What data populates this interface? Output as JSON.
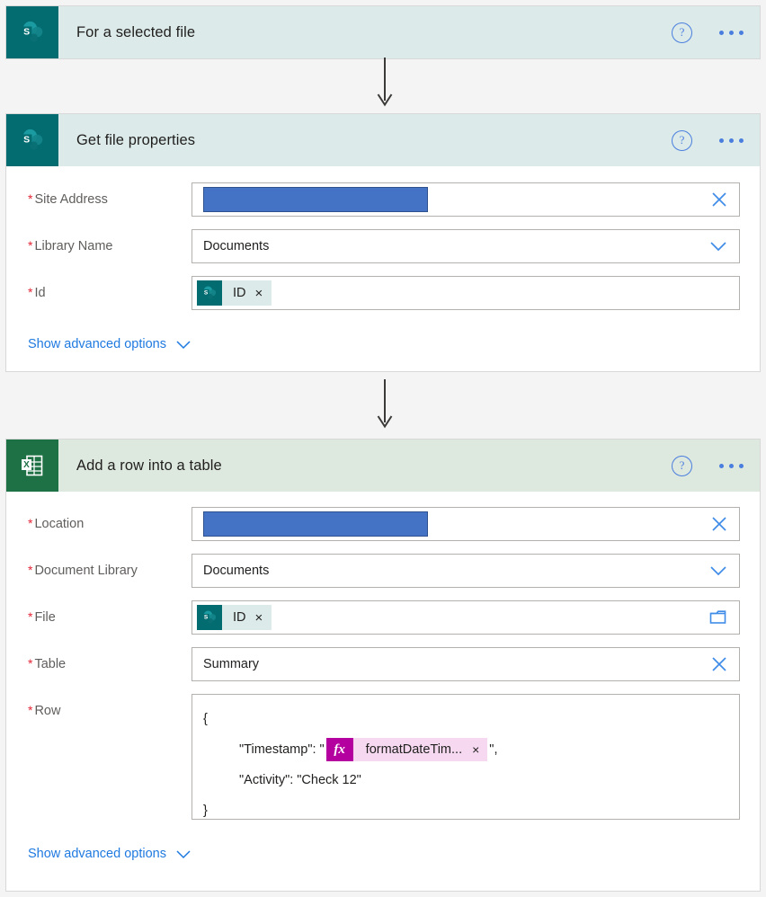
{
  "flow": {
    "steps": [
      {
        "id": "trigger",
        "title": "For a selected file",
        "connector": "SharePoint",
        "icon": "sharepoint-icon",
        "header_bg": "#dcebea",
        "icon_bg": "#036c70",
        "help_label": "?",
        "more_label": "More commands",
        "fields": []
      },
      {
        "id": "get-file-properties",
        "title": "Get file properties",
        "connector": "SharePoint",
        "icon": "sharepoint-icon",
        "header_bg": "#dcebea",
        "icon_bg": "#036c70",
        "help_label": "?",
        "more_label": "More commands",
        "advanced_label": "Show advanced options",
        "fields": [
          {
            "label": "Site Address",
            "required": true,
            "type": "redacted",
            "value": "",
            "trailing_icon": "close-icon"
          },
          {
            "label": "Library Name",
            "required": true,
            "type": "text",
            "value": "Documents",
            "trailing_icon": "chevron-down-icon"
          },
          {
            "label": "Id",
            "required": true,
            "type": "token",
            "token_label": "ID",
            "token_icon": "sharepoint-icon",
            "token_remove": "×",
            "trailing_icon": "none"
          }
        ]
      },
      {
        "id": "add-row-into-table",
        "title": "Add a row into a table",
        "connector": "Excel Online (Business)",
        "icon": "excel-icon",
        "header_bg": "#dde8df",
        "icon_bg": "#1e7145",
        "help_label": "?",
        "more_label": "More commands",
        "advanced_label": "Show advanced options",
        "fields": [
          {
            "label": "Location",
            "required": true,
            "type": "redacted",
            "value": "",
            "trailing_icon": "close-icon"
          },
          {
            "label": "Document Library",
            "required": true,
            "type": "text",
            "value": "Documents",
            "trailing_icon": "chevron-down-icon"
          },
          {
            "label": "File",
            "required": true,
            "type": "token",
            "token_label": "ID",
            "token_icon": "sharepoint-icon",
            "token_remove": "×",
            "trailing_icon": "folder-icon"
          },
          {
            "label": "Table",
            "required": true,
            "type": "text",
            "value": "Summary",
            "trailing_icon": "close-icon"
          },
          {
            "label": "Row",
            "required": true,
            "type": "code",
            "code": {
              "line_open": "{",
              "timestamp_prefix": "\"Timestamp\": \"",
              "timestamp_token": "formatDateTim...",
              "timestamp_token_badge": "fx",
              "timestamp_token_remove": "×",
              "timestamp_suffix": "\",",
              "activity_line": "\"Activity\": \"Check 12\"",
              "line_close": "}"
            }
          }
        ]
      }
    ]
  },
  "colors": {
    "sharepoint_teal": "#036c70",
    "sharepoint_header": "#dcebea",
    "excel_green": "#1e7145",
    "excel_header": "#dde8df",
    "redaction_blue": "#4472c4",
    "link_blue": "#1f7ae0",
    "required_red": "#e32636",
    "expression_magenta": "#b4009e",
    "expression_pink": "#f6d9f0",
    "canvas_gray": "#f4f4f4"
  }
}
